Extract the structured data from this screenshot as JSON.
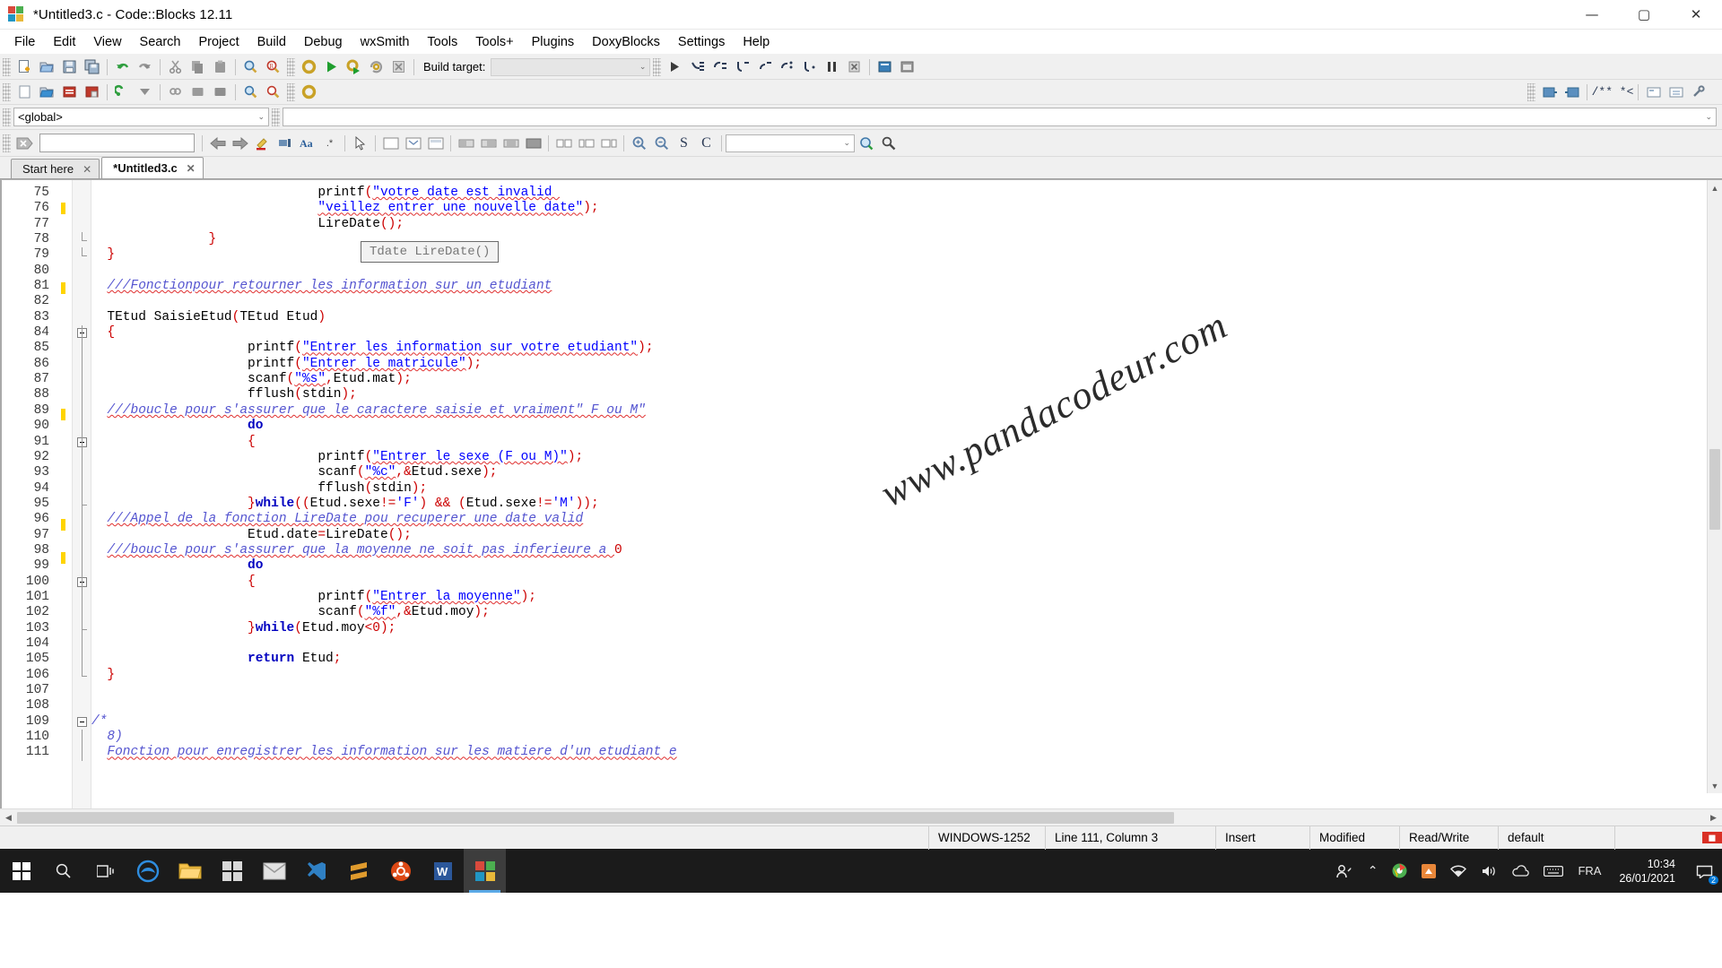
{
  "window": {
    "title": "*Untitled3.c - Code::Blocks 12.11",
    "app_icon": "codeblocks-logo-icon",
    "minimize": "—",
    "maximize": "▢",
    "close": "✕"
  },
  "menubar": {
    "items": [
      {
        "label": "File"
      },
      {
        "label": "Edit"
      },
      {
        "label": "View"
      },
      {
        "label": "Search"
      },
      {
        "label": "Project"
      },
      {
        "label": "Build"
      },
      {
        "label": "Debug"
      },
      {
        "label": "wxSmith"
      },
      {
        "label": "Tools"
      },
      {
        "label": "Tools+"
      },
      {
        "label": "Plugins"
      },
      {
        "label": "DoxyBlocks"
      },
      {
        "label": "Settings"
      },
      {
        "label": "Help"
      }
    ]
  },
  "toolbar_main": {
    "icons": [
      {
        "name": "new-file-icon"
      },
      {
        "name": "open-file-icon"
      },
      {
        "name": "save-icon"
      },
      {
        "name": "save-all-icon"
      },
      {
        "name": "undo-icon"
      },
      {
        "name": "redo-icon"
      },
      {
        "name": "cut-icon"
      },
      {
        "name": "copy-icon"
      },
      {
        "name": "paste-icon"
      },
      {
        "name": "find-icon"
      },
      {
        "name": "replace-icon"
      }
    ]
  },
  "toolbar_build": {
    "icons": [
      {
        "name": "build-icon"
      },
      {
        "name": "run-icon"
      },
      {
        "name": "build-and-run-icon"
      },
      {
        "name": "rebuild-icon"
      },
      {
        "name": "abort-icon"
      }
    ],
    "build_target_label": "Build target:",
    "build_target_value": ""
  },
  "toolbar_debug": {
    "icons": [
      {
        "name": "debug-continue-icon"
      },
      {
        "name": "debug-run-to-cursor-icon"
      },
      {
        "name": "debug-next-line-icon"
      },
      {
        "name": "debug-step-into-icon"
      },
      {
        "name": "debug-step-out-icon"
      },
      {
        "name": "debug-next-instruction-icon"
      },
      {
        "name": "debug-step-into-instruction-icon"
      },
      {
        "name": "debug-break-icon"
      },
      {
        "name": "debug-stop-icon"
      },
      {
        "name": "debugging-windows-icon"
      },
      {
        "name": "various-info-icon"
      }
    ]
  },
  "toolbar_doxyblocks": {
    "icons": [
      {
        "name": "doxyblocks-extract-icon"
      },
      {
        "name": "doxyblocks-run-icon"
      },
      {
        "name": "doxyblocks-comment-icon"
      },
      {
        "name": "doxyblocks-block-comment-icon"
      },
      {
        "name": "doxyblocks-config-icon"
      },
      {
        "name": "doxyblocks-wizard-icon"
      },
      {
        "name": "doxyblocks-settings-icon"
      }
    ],
    "comment_glyph": "/** *<"
  },
  "scope_bar": {
    "scope_value": "<global>",
    "symbol_value": "",
    "dropdown_arrow": "⌄"
  },
  "wxsmith_bar": {
    "close_icon": "close-tag-icon",
    "search_value": "",
    "icons": [
      {
        "name": "back-arrow-icon"
      },
      {
        "name": "forward-arrow-icon"
      },
      {
        "name": "highlight-icon"
      },
      {
        "name": "selected-text-icon"
      },
      {
        "name": "match-case-icon"
      },
      {
        "name": "regex-icon"
      },
      {
        "name": "pointer-tool-icon"
      },
      {
        "name": "panel-tool-icon"
      },
      {
        "name": "dialog-tool-icon"
      },
      {
        "name": "frame-tool-icon"
      },
      {
        "name": "box-sizer-icon"
      },
      {
        "name": "grid-sizer-icon"
      },
      {
        "name": "flex-grid-sizer-icon"
      },
      {
        "name": "static-box-sizer-icon"
      },
      {
        "name": "spacer-icon"
      },
      {
        "name": "stretch-spacer-icon"
      },
      {
        "name": "zoom-in-icon"
      },
      {
        "name": "zoom-out-icon"
      },
      {
        "name": "select-tool-icon"
      },
      {
        "name": "clear-tool-icon"
      },
      {
        "name": "goto-declaration-icon"
      },
      {
        "name": "symbol-search-icon"
      }
    ],
    "symbol_select_value": ""
  },
  "tabs": [
    {
      "label": "Start here",
      "active": false,
      "close": "✕"
    },
    {
      "label": "*Untitled3.c",
      "active": true,
      "close": "✕"
    }
  ],
  "editor": {
    "calltip": "Tdate LireDate()",
    "watermark": "www.pandacodeur.com",
    "first_line": 75,
    "lines": [
      {
        "n": 75,
        "mark": false,
        "fold": "",
        "html": "                             <span class=\"c-pl\">printf</span><span class=\"c-pun\">(</span><span class=\"c-str sq\">\"votre date est invalid </span>"
      },
      {
        "n": 76,
        "mark": true,
        "fold": "",
        "html": "                             <span class=\"c-str sq\">\"veillez entrer une nouvelle date\"</span><span class=\"c-pun\">);</span>"
      },
      {
        "n": 77,
        "mark": false,
        "fold": "",
        "html": "                             <span class=\"c-pl\">LireDate</span><span class=\"c-pun\">();</span>"
      },
      {
        "n": 78,
        "mark": false,
        "fold": "end-inner",
        "html": "               <span class=\"c-pun\">}</span>"
      },
      {
        "n": 79,
        "mark": false,
        "fold": "end-outer",
        "html": "  <span class=\"c-pun\">}</span>"
      },
      {
        "n": 80,
        "mark": false,
        "fold": "",
        "html": ""
      },
      {
        "n": 81,
        "mark": true,
        "fold": "",
        "html": "  <span class=\"c-cmt sq\">///Fonctionpour retourner les information sur un etudiant</span>"
      },
      {
        "n": 82,
        "mark": false,
        "fold": "",
        "html": ""
      },
      {
        "n": 83,
        "mark": false,
        "fold": "",
        "html": "  <span class=\"c-pl\">TEtud SaisieEtud</span><span class=\"c-pun\">(</span><span class=\"c-pl\">TEtud Etud</span><span class=\"c-pun\">)</span>"
      },
      {
        "n": 84,
        "mark": false,
        "fold": "start",
        "html": "  <span class=\"c-pun\">{</span>"
      },
      {
        "n": 85,
        "mark": false,
        "fold": "bar",
        "html": "                    <span class=\"c-pl\">printf</span><span class=\"c-pun\">(</span><span class=\"c-str sq\">\"Entrer les information sur votre etudiant\"</span><span class=\"c-pun\">);</span>"
      },
      {
        "n": 86,
        "mark": false,
        "fold": "bar",
        "html": "                    <span class=\"c-pl\">printf</span><span class=\"c-pun\">(</span><span class=\"c-str sq\">\"Entrer le matricule\"</span><span class=\"c-pun\">);</span>"
      },
      {
        "n": 87,
        "mark": false,
        "fold": "bar",
        "html": "                    <span class=\"c-pl\">scanf</span><span class=\"c-pun\">(</span><span class=\"c-str sq\">\"%s\"</span><span class=\"c-pun\">,</span><span class=\"c-pl\">Etud.mat</span><span class=\"c-pun\">);</span>"
      },
      {
        "n": 88,
        "mark": false,
        "fold": "bar",
        "html": "                    <span class=\"c-pl\">fflush</span><span class=\"c-pun\">(</span><span class=\"c-pl\">stdin</span><span class=\"c-pun\">);</span>"
      },
      {
        "n": 89,
        "mark": true,
        "fold": "bar",
        "html": "  <span class=\"c-cmt sq\">///boucle pour s'assurer que le caractere saisie et vraiment\" F ou M\"</span>"
      },
      {
        "n": 90,
        "mark": false,
        "fold": "bar",
        "html": "                    <span class=\"c-kw\">do</span>"
      },
      {
        "n": 91,
        "mark": false,
        "fold": "start2",
        "html": "                    <span class=\"c-pun\">{</span>"
      },
      {
        "n": 92,
        "mark": false,
        "fold": "bar2",
        "html": "                             <span class=\"c-pl\">printf</span><span class=\"c-pun\">(</span><span class=\"c-str sq\">\"Entrer le sexe (F ou M)\"</span><span class=\"c-pun\">);</span>"
      },
      {
        "n": 93,
        "mark": false,
        "fold": "bar2",
        "html": "                             <span class=\"c-pl\">scanf</span><span class=\"c-pun\">(</span><span class=\"c-str sq\">\"%c\"</span><span class=\"c-pun\">,&amp;</span><span class=\"c-pl\">Etud.sexe</span><span class=\"c-pun\">);</span>"
      },
      {
        "n": 94,
        "mark": false,
        "fold": "bar2",
        "html": "                             <span class=\"c-pl\">fflush</span><span class=\"c-pun\">(</span><span class=\"c-pl\">stdin</span><span class=\"c-pun\">);</span>"
      },
      {
        "n": 95,
        "mark": false,
        "fold": "end2",
        "html": "                    <span class=\"c-pun\">}</span><span class=\"c-kw\">while</span><span class=\"c-pun\">((</span><span class=\"c-pl\">Etud.sexe</span><span class=\"c-pun\">!=</span><span class=\"c-str\">'F'</span><span class=\"c-pun\">) &amp;&amp; (</span><span class=\"c-pl\">Etud.sexe</span><span class=\"c-pun\">!=</span><span class=\"c-str\">'M'</span><span class=\"c-pun\">));</span>"
      },
      {
        "n": 96,
        "mark": true,
        "fold": "bar",
        "html": "  <span class=\"c-cmt sq\">///Appel de la fonction LireDate pou recuperer une date valid</span>"
      },
      {
        "n": 97,
        "mark": false,
        "fold": "bar",
        "html": "                    <span class=\"c-pl\">Etud.date</span><span class=\"c-pun\">=</span><span class=\"c-pl\">LireDate</span><span class=\"c-pun\">();</span>"
      },
      {
        "n": 98,
        "mark": true,
        "fold": "bar",
        "html": "  <span class=\"c-cmt sq\">///boucle pour s'assurer que la moyenne ne soit pas inferieure a </span><span class=\"c-num\">0</span>"
      },
      {
        "n": 99,
        "mark": false,
        "fold": "bar",
        "html": "                    <span class=\"c-kw\">do</span>"
      },
      {
        "n": 100,
        "mark": false,
        "fold": "start3",
        "html": "                    <span class=\"c-pun\">{</span>"
      },
      {
        "n": 101,
        "mark": false,
        "fold": "bar3",
        "html": "                             <span class=\"c-pl\">printf</span><span class=\"c-pun\">(</span><span class=\"c-str sq\">\"Entrer la moyenne\"</span><span class=\"c-pun\">);</span>"
      },
      {
        "n": 102,
        "mark": false,
        "fold": "bar3",
        "html": "                             <span class=\"c-pl\">scanf</span><span class=\"c-pun\">(</span><span class=\"c-str sq\">\"%f\"</span><span class=\"c-pun\">,&amp;</span><span class=\"c-pl\">Etud.moy</span><span class=\"c-pun\">);</span>"
      },
      {
        "n": 103,
        "mark": false,
        "fold": "end3",
        "html": "                    <span class=\"c-pun\">}</span><span class=\"c-kw\">while</span><span class=\"c-pun\">(</span><span class=\"c-pl\">Etud.moy</span><span class=\"c-pun\">&lt;</span><span class=\"c-num\">0</span><span class=\"c-pun\">);</span>"
      },
      {
        "n": 104,
        "mark": false,
        "fold": "bar",
        "html": ""
      },
      {
        "n": 105,
        "mark": false,
        "fold": "bar",
        "html": "                    <span class=\"c-kw\">return</span> <span class=\"c-pl\">Etud</span><span class=\"c-pun\">;</span>"
      },
      {
        "n": 106,
        "mark": false,
        "fold": "endmain",
        "html": "  <span class=\"c-pun\">}</span>"
      },
      {
        "n": 107,
        "mark": false,
        "fold": "",
        "html": ""
      },
      {
        "n": 108,
        "mark": false,
        "fold": "",
        "html": ""
      },
      {
        "n": 109,
        "mark": false,
        "fold": "start4",
        "html": "<span class=\"c-cmt\">/*</span>"
      },
      {
        "n": 110,
        "mark": false,
        "fold": "bar4",
        "html": "  <span class=\"c-cmt\">8)</span>"
      },
      {
        "n": 111,
        "mark": false,
        "fold": "bar4",
        "html": "  <span class=\"c-cmt sq\">Fonction pour enregistrer les information sur les matiere d'un etudiant e</span>"
      }
    ]
  },
  "statusbar": {
    "encoding": "WINDOWS-1252",
    "position": "Line 111, Column 3",
    "insert_mode": "Insert",
    "modified": "Modified",
    "permissions": "Read/Write",
    "profile": "default",
    "indicator": "indicator-red-icon"
  },
  "taskbar": {
    "start": "windows-start-icon",
    "search": "search-icon",
    "task_view": "task-view-icon",
    "apps": [
      {
        "name": "edge-browser",
        "glyph": "e",
        "color": "#2e8ddf"
      },
      {
        "name": "file-explorer",
        "glyph": "folder",
        "color": "#f5c24b"
      },
      {
        "name": "microsoft-store",
        "glyph": "store",
        "color": "#d8d8d8"
      },
      {
        "name": "mail",
        "glyph": "mail",
        "color": "#d8d8d8"
      },
      {
        "name": "visual-studio-code",
        "glyph": "vscode",
        "color": "#2f80c4"
      },
      {
        "name": "sublime-text",
        "glyph": "S",
        "color": "#e09b2d"
      },
      {
        "name": "ubuntu-wsl",
        "glyph": "U",
        "color": "#dd4814"
      },
      {
        "name": "microsoft-word",
        "glyph": "W",
        "color": "#2b579a"
      },
      {
        "name": "codeblocks",
        "glyph": "cb",
        "color": "#888"
      }
    ],
    "tray": {
      "people_icon": "people-icon",
      "chevron_up": "⌃",
      "icons": [
        {
          "name": "chrome-tray-icon"
        },
        {
          "name": "app-tray-icon"
        },
        {
          "name": "network-icon"
        },
        {
          "name": "volume-icon"
        },
        {
          "name": "onedrive-icon"
        },
        {
          "name": "keyboard-icon"
        }
      ],
      "language": "FRA",
      "time": "10:34",
      "date": "26/01/2021",
      "notifications": "notification-icon",
      "notification_count": "2"
    }
  }
}
